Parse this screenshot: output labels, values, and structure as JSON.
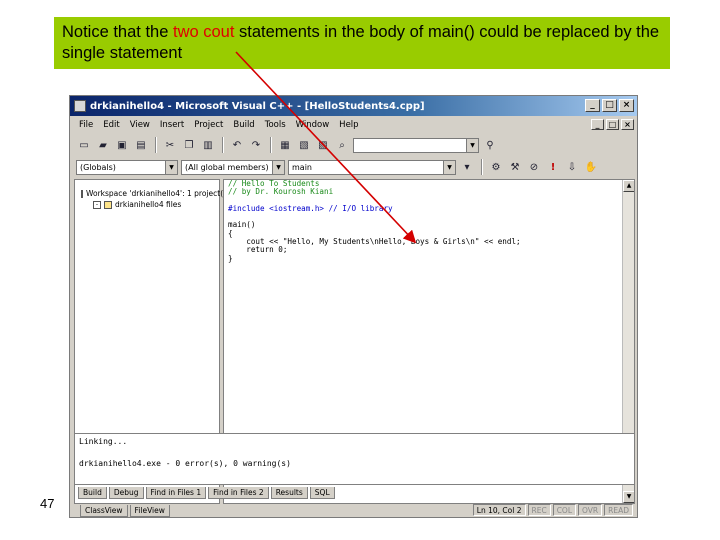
{
  "note": {
    "pre": "Notice that the ",
    "highlight": "two cout",
    "post": " statements in the body of main() could be replaced by the single statement"
  },
  "slide_number": "47",
  "ide": {
    "title": "drkianihello4 - Microsoft Visual C++ - [HelloStudents4.cpp]",
    "window_buttons": [
      "_",
      "□",
      "×"
    ],
    "menus": [
      "File",
      "Edit",
      "View",
      "Insert",
      "Project",
      "Build",
      "Tools",
      "Window",
      "Help"
    ],
    "combo_class": "(Globals)",
    "combo_members": "(All global members)",
    "combo_function": "main",
    "workspace_tree": [
      "Workspace 'drkianihello4': 1 project(s)",
      "drkianihello4 files"
    ],
    "workspace_tabs": [
      "ClassView",
      "FileView"
    ],
    "code_lines": [
      {
        "text": "// Hello To Students",
        "type": "cmt"
      },
      {
        "text": "// by Dr. Kourosh Kiani",
        "type": "cmt"
      },
      {
        "text": "",
        "type": "plain"
      },
      {
        "text": "#include <iostream.h> // I/O library",
        "type": "kw"
      },
      {
        "text": "",
        "type": "plain"
      },
      {
        "text": "main()",
        "type": "plain"
      },
      {
        "text": "{",
        "type": "plain"
      },
      {
        "text": "    cout << \"Hello, My Students\\nHello, Boys & Girls\\n\" << endl;",
        "type": "plain"
      },
      {
        "text": "    return 0;",
        "type": "plain"
      },
      {
        "text": "}",
        "type": "plain"
      }
    ],
    "output_lines": [
      "Linking...",
      "",
      "drkianihello4.exe - 0 error(s), 0 warning(s)"
    ],
    "output_tabs": [
      "Build",
      "Debug",
      "Find in Files 1",
      "Find in Files 2",
      "Results",
      "SQL"
    ],
    "status": [
      "Ln 10, Col 2",
      "REC",
      "COL",
      "OVR",
      "READ"
    ]
  },
  "colors": {
    "note_bg": "#99cc00",
    "highlight": "#e00000",
    "arrow": "#d40000"
  }
}
